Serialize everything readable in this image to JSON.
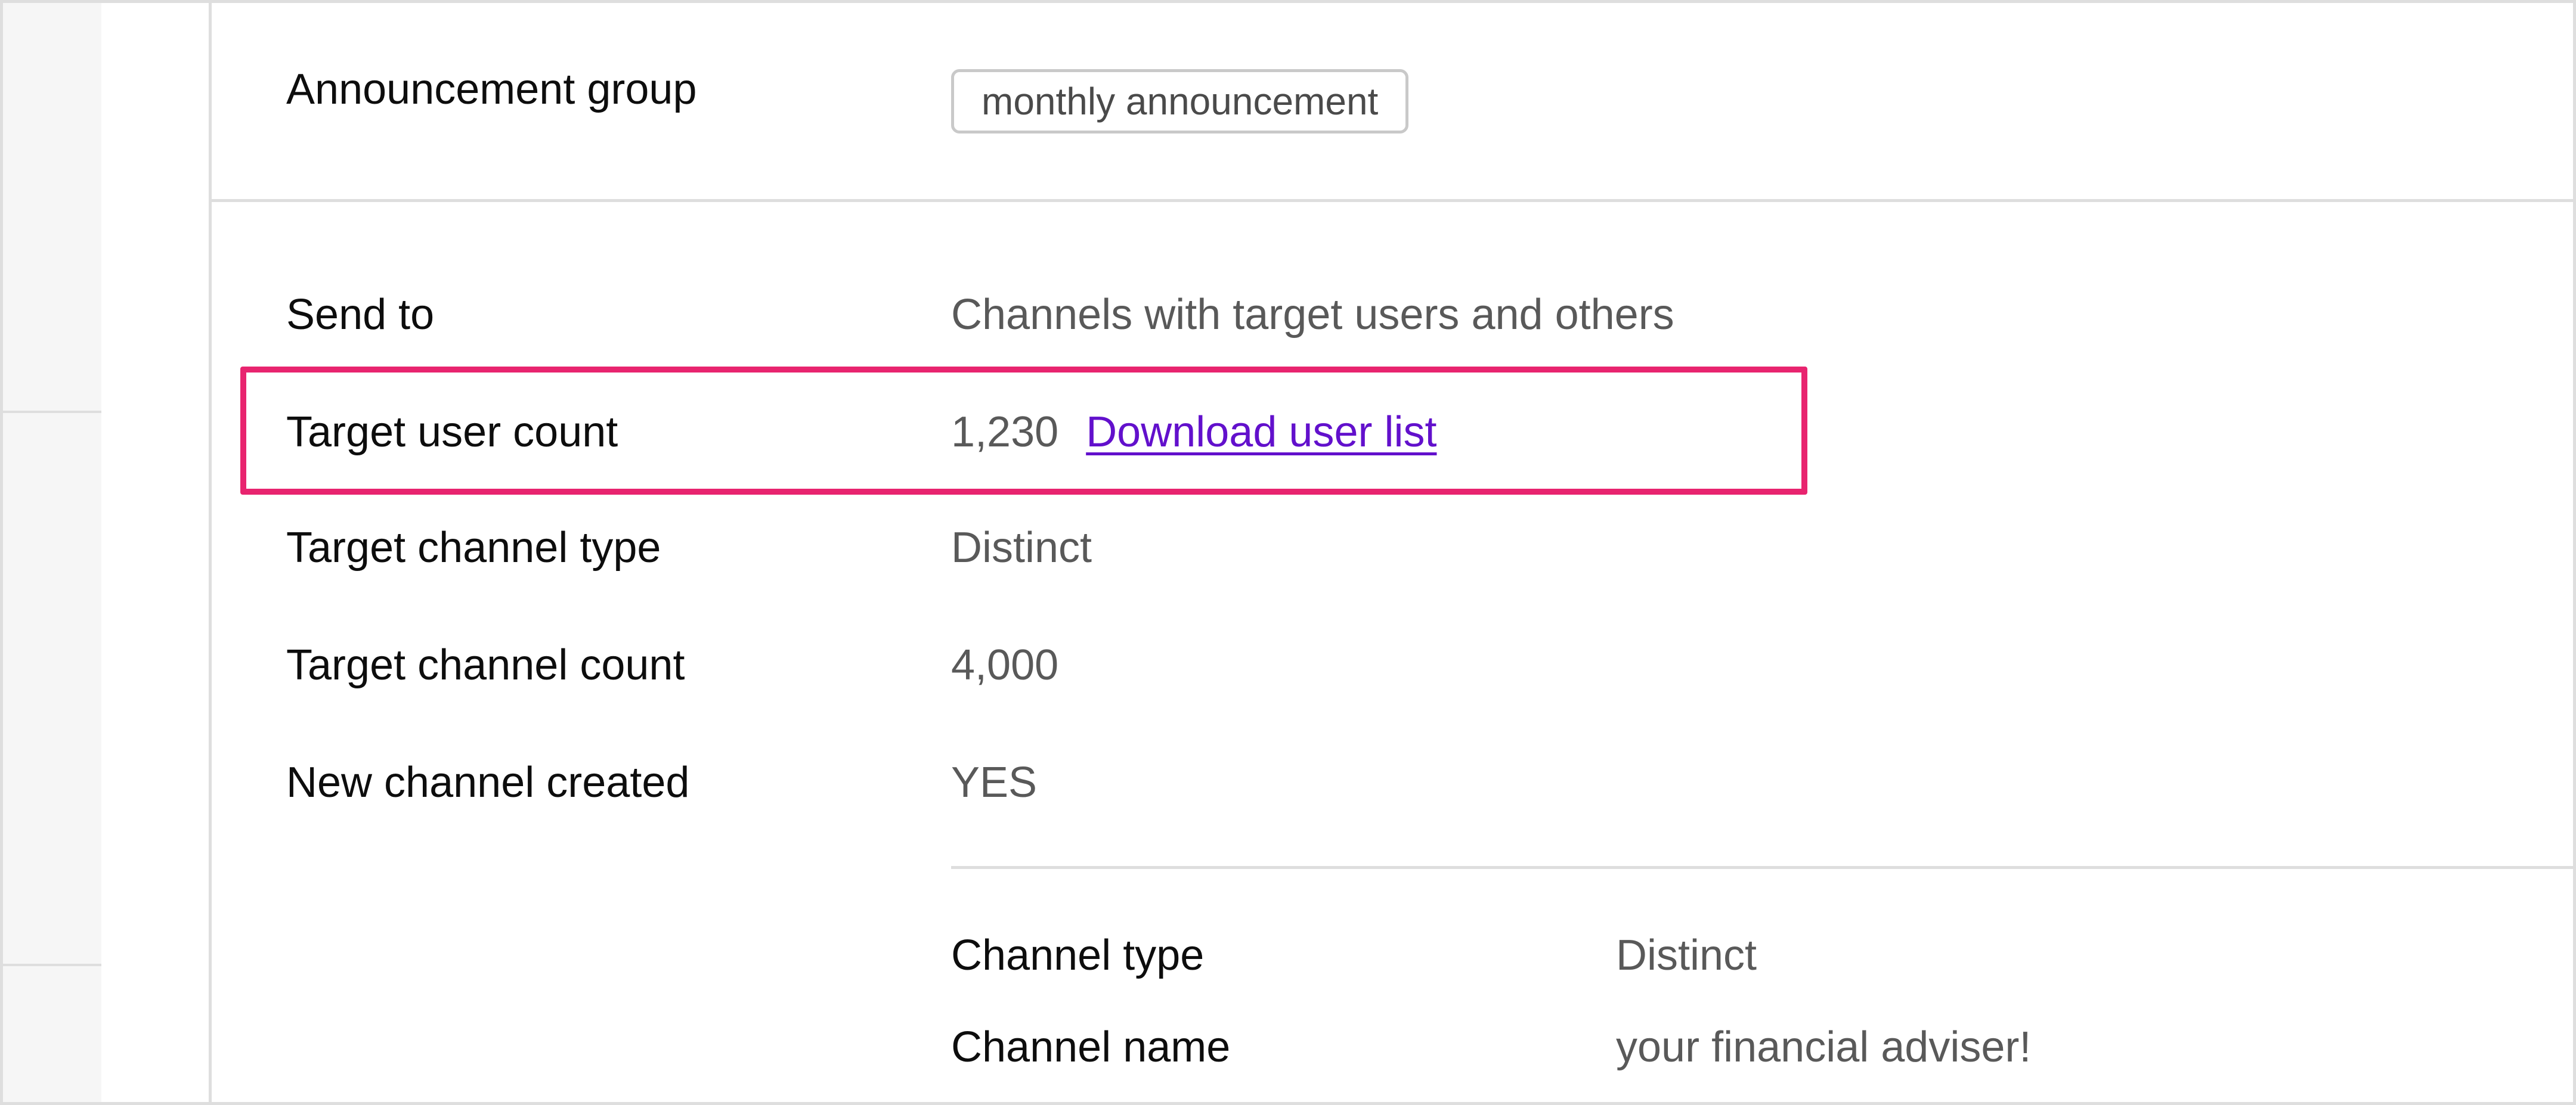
{
  "announcement": {
    "group_label": "Announcement group",
    "group_tag": "monthly announcement"
  },
  "details": {
    "send_to": {
      "label": "Send to",
      "value": "Channels with target users and others"
    },
    "target_user_count": {
      "label": "Target user count",
      "value": "1,230",
      "link": "Download user list"
    },
    "target_channel_type": {
      "label": "Target channel type",
      "value": "Distinct"
    },
    "target_channel_count": {
      "label": "Target channel count",
      "value": "4,000"
    },
    "new_channel_created": {
      "label": "New channel created",
      "value": "YES"
    }
  },
  "channel": {
    "type": {
      "label": "Channel type",
      "value": "Distinct"
    },
    "name": {
      "label": "Channel name",
      "value": "your financial adviser!"
    }
  },
  "colors": {
    "highlight": "#e8246f",
    "link": "#6210cc",
    "border": "#dedede",
    "value_text": "#595959"
  }
}
